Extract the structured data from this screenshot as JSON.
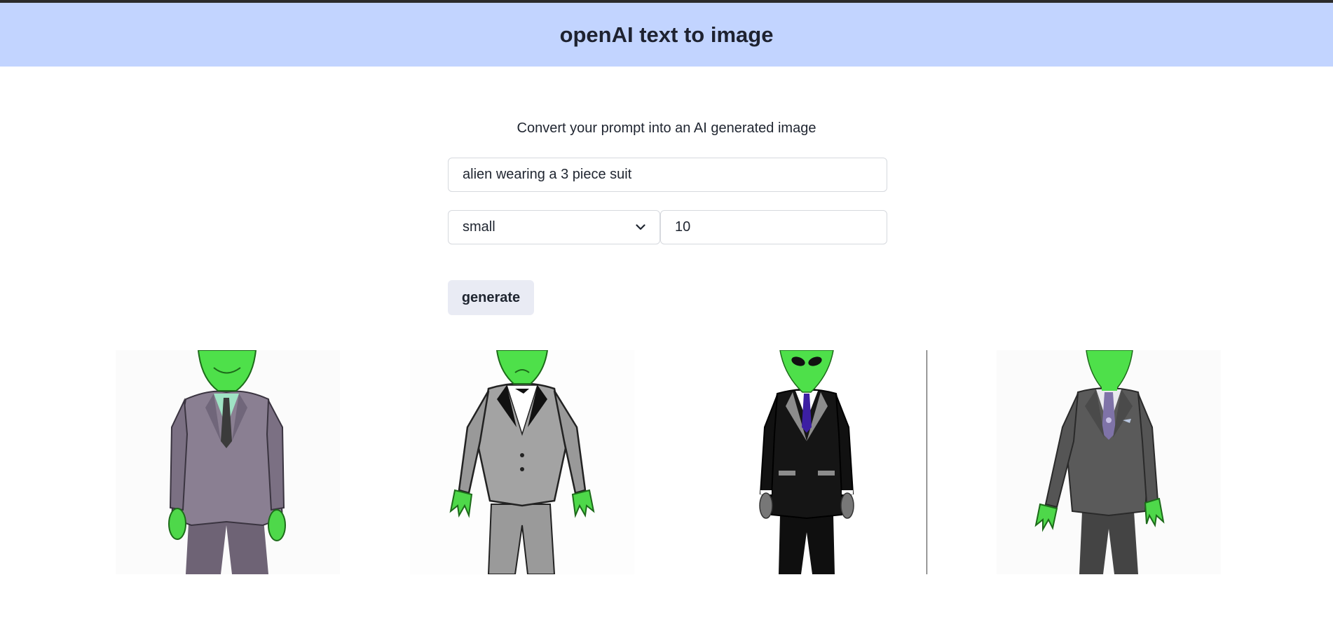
{
  "header": {
    "title": "openAI text to image"
  },
  "form": {
    "subtitle": "Convert your prompt into an AI generated image",
    "prompt_value": "alien wearing a 3 piece suit",
    "size_value": "small",
    "size_icon": "chevron-down-icon",
    "count_value": "10",
    "generate_label": "generate"
  },
  "gallery": {
    "images": [
      {
        "subject": "alien in purple-gray three piece suit"
      },
      {
        "subject": "cartoon alien in light gray tuxedo"
      },
      {
        "subject": "alien in black suit with purple tie"
      },
      {
        "subject": "alien in dark gray suit with patterned tie"
      }
    ]
  },
  "colors": {
    "header_bg": "#c2d4ff",
    "alien_green": "#4ee04a",
    "button_bg": "#e9ebf4"
  }
}
